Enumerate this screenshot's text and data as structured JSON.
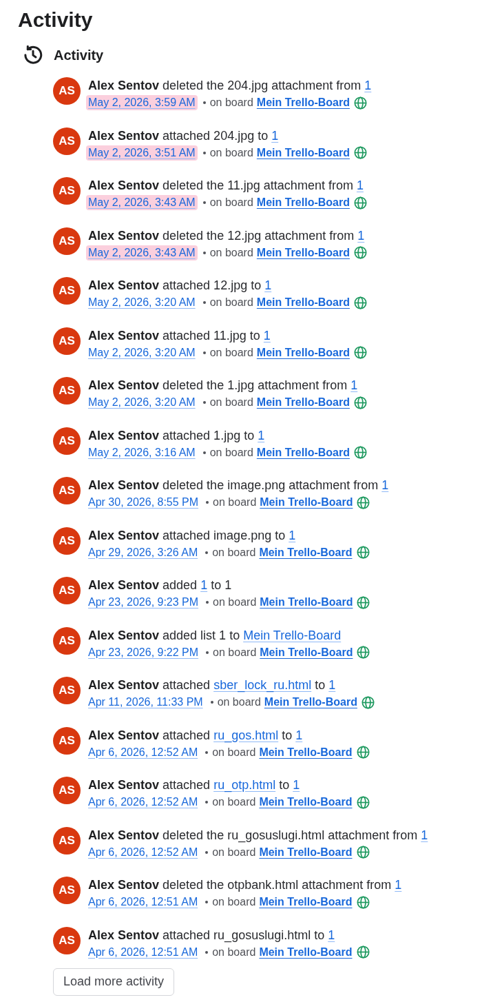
{
  "page": {
    "title": "Activity"
  },
  "section": {
    "title": "Activity"
  },
  "activities": [
    {
      "avatar": "AS",
      "actor": "Alex Sentov",
      "message": [
        {
          "kind": "text",
          "text": "deleted the 204.jpg attachment from"
        },
        {
          "kind": "link",
          "text": "1"
        }
      ],
      "time": "May 2, 2026, 3:59 AM",
      "highlighted": true,
      "board_label": "on board",
      "board": "Mein Trello-Board"
    },
    {
      "avatar": "AS",
      "actor": "Alex Sentov",
      "message": [
        {
          "kind": "text",
          "text": "attached 204.jpg to"
        },
        {
          "kind": "link",
          "text": "1"
        }
      ],
      "time": "May 2, 2026, 3:51 AM",
      "highlighted": true,
      "board_label": "on board",
      "board": "Mein Trello-Board"
    },
    {
      "avatar": "AS",
      "actor": "Alex Sentov",
      "message": [
        {
          "kind": "text",
          "text": "deleted the 11.jpg attachment from"
        },
        {
          "kind": "link",
          "text": "1"
        }
      ],
      "time": "May 2, 2026, 3:43 AM",
      "highlighted": true,
      "board_label": "on board",
      "board": "Mein Trello-Board"
    },
    {
      "avatar": "AS",
      "actor": "Alex Sentov",
      "message": [
        {
          "kind": "text",
          "text": "deleted the 12.jpg attachment from"
        },
        {
          "kind": "link",
          "text": "1"
        }
      ],
      "time": "May 2, 2026, 3:43 AM",
      "highlighted": true,
      "board_label": "on board",
      "board": "Mein Trello-Board"
    },
    {
      "avatar": "AS",
      "actor": "Alex Sentov",
      "message": [
        {
          "kind": "text",
          "text": "attached 12.jpg to"
        },
        {
          "kind": "link",
          "text": "1"
        }
      ],
      "time": "May 2, 2026, 3:20 AM",
      "highlighted": false,
      "board_label": "on board",
      "board": "Mein Trello-Board"
    },
    {
      "avatar": "AS",
      "actor": "Alex Sentov",
      "message": [
        {
          "kind": "text",
          "text": "attached 11.jpg to"
        },
        {
          "kind": "link",
          "text": "1"
        }
      ],
      "time": "May 2, 2026, 3:20 AM",
      "highlighted": false,
      "board_label": "on board",
      "board": "Mein Trello-Board"
    },
    {
      "avatar": "AS",
      "actor": "Alex Sentov",
      "message": [
        {
          "kind": "text",
          "text": "deleted the 1.jpg attachment from"
        },
        {
          "kind": "link",
          "text": "1"
        }
      ],
      "time": "May 2, 2026, 3:20 AM",
      "highlighted": false,
      "board_label": "on board",
      "board": "Mein Trello-Board"
    },
    {
      "avatar": "AS",
      "actor": "Alex Sentov",
      "message": [
        {
          "kind": "text",
          "text": "attached 1.jpg to"
        },
        {
          "kind": "link",
          "text": "1"
        }
      ],
      "time": "May 2, 2026, 3:16 AM",
      "highlighted": false,
      "board_label": "on board",
      "board": "Mein Trello-Board"
    },
    {
      "avatar": "AS",
      "actor": "Alex Sentov",
      "message": [
        {
          "kind": "text",
          "text": "deleted the image.png attachment from"
        },
        {
          "kind": "link",
          "text": "1"
        }
      ],
      "time": "Apr 30, 2026, 8:55 PM",
      "highlighted": false,
      "board_label": "on board",
      "board": "Mein Trello-Board"
    },
    {
      "avatar": "AS",
      "actor": "Alex Sentov",
      "message": [
        {
          "kind": "text",
          "text": "attached image.png to"
        },
        {
          "kind": "link",
          "text": "1"
        }
      ],
      "time": "Apr 29, 2026, 3:26 AM",
      "highlighted": false,
      "board_label": "on board",
      "board": "Mein Trello-Board"
    },
    {
      "avatar": "AS",
      "actor": "Alex Sentov",
      "message": [
        {
          "kind": "text",
          "text": "added"
        },
        {
          "kind": "link",
          "text": "1"
        },
        {
          "kind": "text",
          "text": "to 1"
        }
      ],
      "time": "Apr 23, 2026, 9:23 PM",
      "highlighted": false,
      "board_label": "on board",
      "board": "Mein Trello-Board"
    },
    {
      "avatar": "AS",
      "actor": "Alex Sentov",
      "message": [
        {
          "kind": "text",
          "text": "added list 1 to"
        },
        {
          "kind": "link",
          "text": "Mein Trello-Board"
        }
      ],
      "time": "Apr 23, 2026, 9:22 PM",
      "highlighted": false,
      "board_label": "on board",
      "board": "Mein Trello-Board"
    },
    {
      "avatar": "AS",
      "actor": "Alex Sentov",
      "message": [
        {
          "kind": "text",
          "text": "attached"
        },
        {
          "kind": "link",
          "text": "sber_lock_ru.html"
        },
        {
          "kind": "text",
          "text": "to"
        },
        {
          "kind": "link",
          "text": "1"
        }
      ],
      "time": "Apr 11, 2026, 11:33 PM",
      "highlighted": false,
      "board_label": "on board",
      "board": "Mein Trello-Board"
    },
    {
      "avatar": "AS",
      "actor": "Alex Sentov",
      "message": [
        {
          "kind": "text",
          "text": "attached"
        },
        {
          "kind": "link",
          "text": "ru_gos.html"
        },
        {
          "kind": "text",
          "text": "to"
        },
        {
          "kind": "link",
          "text": "1"
        }
      ],
      "time": "Apr 6, 2026, 12:52 AM",
      "highlighted": false,
      "board_label": "on board",
      "board": "Mein Trello-Board"
    },
    {
      "avatar": "AS",
      "actor": "Alex Sentov",
      "message": [
        {
          "kind": "text",
          "text": "attached"
        },
        {
          "kind": "link",
          "text": "ru_otp.html"
        },
        {
          "kind": "text",
          "text": "to"
        },
        {
          "kind": "link",
          "text": "1"
        }
      ],
      "time": "Apr 6, 2026, 12:52 AM",
      "highlighted": false,
      "board_label": "on board",
      "board": "Mein Trello-Board"
    },
    {
      "avatar": "AS",
      "actor": "Alex Sentov",
      "message": [
        {
          "kind": "text",
          "text": "deleted the ru_gosuslugi.html attachment from"
        },
        {
          "kind": "link",
          "text": "1"
        }
      ],
      "time": "Apr 6, 2026, 12:52 AM",
      "highlighted": false,
      "board_label": "on board",
      "board": "Mein Trello-Board"
    },
    {
      "avatar": "AS",
      "actor": "Alex Sentov",
      "message": [
        {
          "kind": "text",
          "text": "deleted the otpbank.html attachment from"
        },
        {
          "kind": "link",
          "text": "1"
        }
      ],
      "time": "Apr 6, 2026, 12:51 AM",
      "highlighted": false,
      "board_label": "on board",
      "board": "Mein Trello-Board"
    },
    {
      "avatar": "AS",
      "actor": "Alex Sentov",
      "message": [
        {
          "kind": "text",
          "text": "attached ru_gosuslugi.html to"
        },
        {
          "kind": "link",
          "text": "1"
        }
      ],
      "time": "Apr 6, 2026, 12:51 AM",
      "highlighted": false,
      "board_label": "on board",
      "board": "Mein Trello-Board"
    }
  ],
  "load_more": {
    "label": "Load more activity"
  }
}
